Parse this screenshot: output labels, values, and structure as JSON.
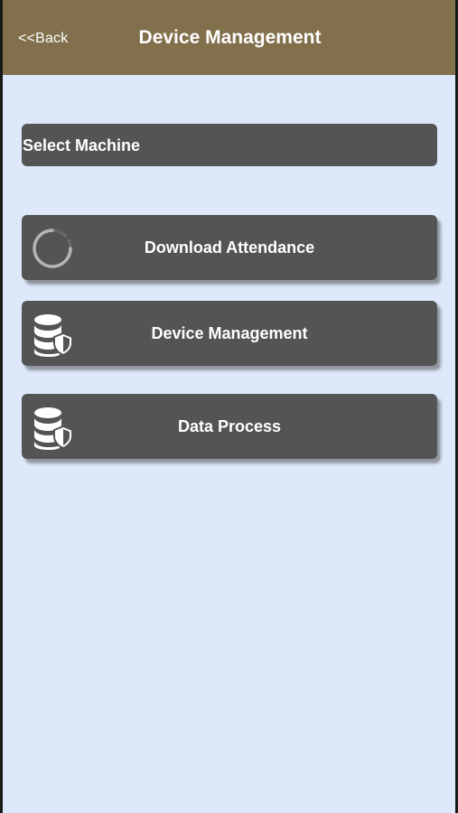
{
  "navbar": {
    "back_label": "<<Back",
    "title": "Device Management",
    "color": "#82704d"
  },
  "select_machine": {
    "label": "Select Machine"
  },
  "menu": {
    "items": [
      {
        "label": "Download Attendance",
        "icon": "loading-spinner-icon"
      },
      {
        "label": "Device Management",
        "icon": "database-shield-icon"
      },
      {
        "label": "Data Process",
        "icon": "database-shield-icon"
      }
    ]
  },
  "colors": {
    "background": "#dde9fb",
    "button": "#545454",
    "button_text": "#ffffff"
  }
}
